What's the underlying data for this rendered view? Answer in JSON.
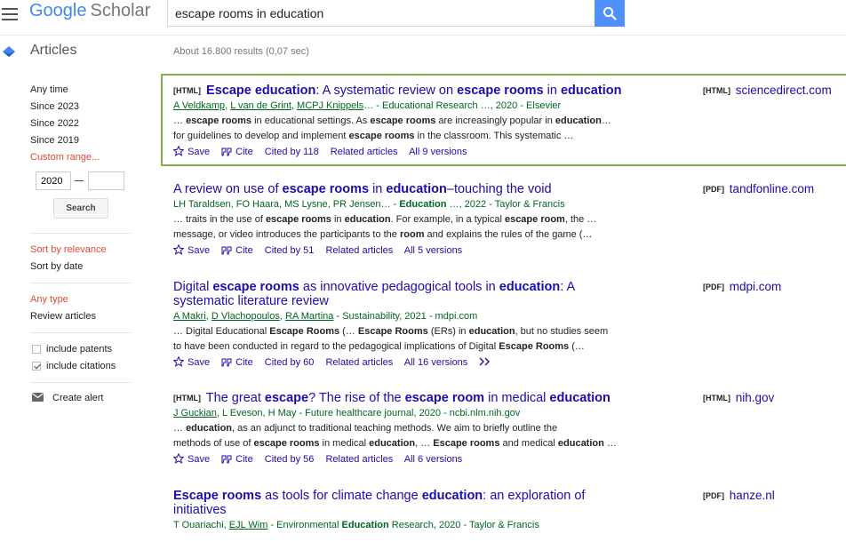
{
  "header": {
    "logo_word1": "Google",
    "logo_word2": "Scholar",
    "search_value": "escape rooms in education"
  },
  "nav": {
    "section_title": "Articles"
  },
  "results_count": "About 16.800 results (0,07 sec)",
  "sidebar": {
    "time_filters": [
      "Any time",
      "Since 2023",
      "Since 2022",
      "Since 2019"
    ],
    "custom_range": "Custom range...",
    "range_from": "2020",
    "range_to": "",
    "search_button": "Search",
    "sort_relevance": "Sort by relevance",
    "sort_date": "Sort by date",
    "type_any": "Any type",
    "type_review": "Review articles",
    "include_patents": "include patents",
    "include_citations": "include citations",
    "create_alert": "Create alert"
  },
  "actions": {
    "save": "Save",
    "cite": "Cite",
    "related": "Related articles"
  },
  "results": [
    {
      "tag": "[HTML]",
      "title_parts": [
        "Escape education",
        ": A systematic review on ",
        "escape rooms",
        " in ",
        "education"
      ],
      "authors": [
        "A Veldkamp",
        ", ",
        "L van de Grint",
        ", ",
        "MCPJ Knippels",
        "… - Educational Research …, 2020 - Elsevier"
      ],
      "snippet1": [
        "… ",
        "escape rooms",
        " in educational settings. As ",
        "escape rooms",
        " are increasingly popular in ",
        "education",
        "…"
      ],
      "snippet2": [
        "for guidelines to develop and implement ",
        "escape rooms",
        " in the classroom. This systematic …"
      ],
      "cited_by": "Cited by 118",
      "versions": "All 9 versions",
      "side_tag": "[HTML]",
      "side_domain": "sciencedirect.com"
    },
    {
      "tag": "",
      "title_parts": [
        "A review on use of ",
        "escape rooms",
        " in ",
        "education",
        "–touching the void"
      ],
      "authors": [
        "LH Taraldsen, FO Haara, MS Lysne, PR Jensen… - ",
        "Education",
        " …, 2022 - Taylor & Francis"
      ],
      "snippet1": [
        "… traits in the use of ",
        "escape rooms",
        " in ",
        "education",
        ". For example, in a typical ",
        "escape room",
        ", the …"
      ],
      "snippet2": [
        "message, or video introduces the participants to the ",
        "room",
        " and explains the rules of the game (…"
      ],
      "cited_by": "Cited by 51",
      "versions": "All 5 versions",
      "side_tag": "[PDF]",
      "side_domain": "tandfonline.com"
    },
    {
      "tag": "",
      "title_line1": [
        "Digital ",
        "escape rooms",
        " as innovative pedagogical tools in ",
        "education",
        ": A"
      ],
      "title_line2": "systematic literature review",
      "authors": [
        "A Makri",
        ", ",
        "D Vlachopoulos",
        ", ",
        "RA Martina",
        " - Sustainability, 2021 - mdpi.com"
      ],
      "snippet1": [
        "… Digital Educational ",
        "Escape Rooms",
        " (… ",
        "Escape Rooms",
        " (ERs) in ",
        "education",
        ", but no studies seem"
      ],
      "snippet2": [
        "to have been conducted in regard to the pedagogical implications of Digital ",
        "Escape Rooms",
        " (…"
      ],
      "cited_by": "Cited by 60",
      "versions": "All 16 versions",
      "side_tag": "[PDF]",
      "side_domain": "mdpi.com"
    },
    {
      "tag": "[HTML]",
      "title_parts": [
        "The great ",
        "escape",
        "? The rise of the ",
        "escape room",
        " in medical ",
        "education"
      ],
      "authors": [
        "J Guckian",
        ", L Eveson, H May - Future healthcare journal, 2020 - ncbi.nlm.nih.gov"
      ],
      "snippet1": [
        "… ",
        "education",
        ", as an adjunct to traditional teaching methods. We aim to briefly outline the"
      ],
      "snippet2": [
        "methods of use of ",
        "escape rooms",
        " in medical ",
        "education",
        ", … ",
        "Escape rooms",
        " and medical ",
        "education",
        " …"
      ],
      "cited_by": "Cited by 56",
      "versions": "All 6 versions",
      "side_tag": "[HTML]",
      "side_domain": "nih.gov"
    },
    {
      "tag": "",
      "title_line1": [
        "Escape rooms",
        " as tools for climate change ",
        "education",
        ": an exploration of"
      ],
      "title_line2": "initiatives",
      "authors": [
        "T Ouariachi, ",
        "EJL Wim",
        " - Environmental ",
        "Education",
        " Research, 2020 - Taylor & Francis"
      ],
      "side_tag": "[PDF]",
      "side_domain": "hanze.nl"
    }
  ],
  "colors": {
    "link": "#1a0dab",
    "green": "#006621",
    "accent": "#dd4b39",
    "highlight": "#7cb342",
    "search_blue": "#4d90fe"
  }
}
